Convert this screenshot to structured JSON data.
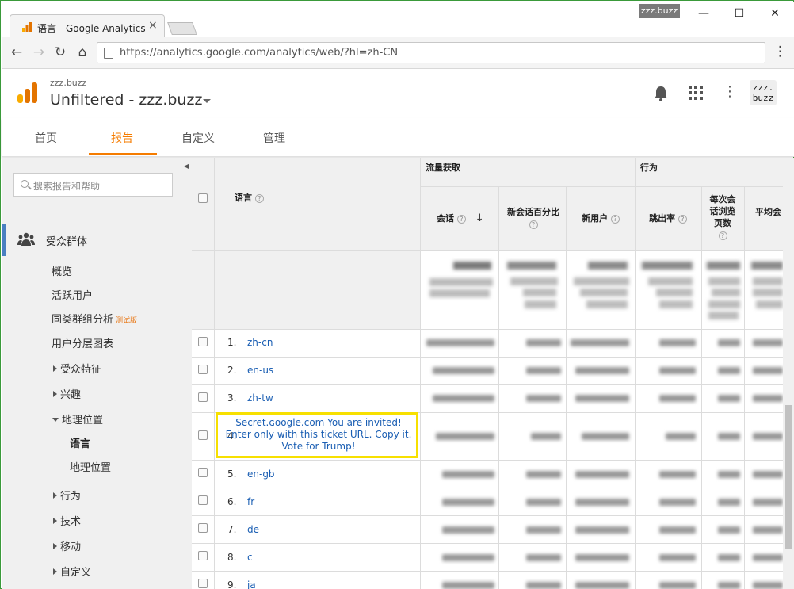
{
  "browser": {
    "tab_title": "语言 - Google Analytics",
    "tab_close": "×",
    "user_badge": "zzz.buzz",
    "url": "https://analytics.google.com/analytics/web/?hl=zh-CN",
    "win_min": "—",
    "win_max": "☐",
    "win_close": "✕",
    "back": "←",
    "forward": "→",
    "reload": "↻",
    "home": "⌂",
    "menu": "⋮"
  },
  "header": {
    "account": "zzz.buzz",
    "view": "Unfiltered - zzz.buzz",
    "avatar_line1": "zzz.",
    "avatar_line2": "buzz",
    "menu": "⋮"
  },
  "nav_tabs": [
    "首页",
    "报告",
    "自定义",
    "管理"
  ],
  "active_tab": "报告",
  "sidebar": {
    "search_placeholder": "搜索报告和帮助",
    "section": "受众群体",
    "items": {
      "overview": "概览",
      "active_users": "活跃用户",
      "cohort": "同类群组分析",
      "cohort_badge": "测试版",
      "user_explorer": "用户分层图表",
      "demographics": "受众特征",
      "interests": "兴趣",
      "geo": "地理位置",
      "geo_language": "语言",
      "geo_location": "地理位置",
      "behavior": "行为",
      "technology": "技术",
      "mobile": "移动",
      "custom": "自定义"
    },
    "collapse": "◀"
  },
  "table": {
    "col_language": "语言",
    "group_acquisition": "流量获取",
    "group_behavior": "行为",
    "col_sessions": "会话",
    "sort_arrow": "↓",
    "col_new_pct": "新会话百分比",
    "col_new_users": "新用户",
    "col_bounce": "跳出率",
    "col_pages_l1": "每次会",
    "col_pages_l2": "话浏览",
    "col_pages_l3": "页数",
    "col_avg": "平均会",
    "help": "?",
    "rows": [
      {
        "num": "1.",
        "lang": "zh-cn"
      },
      {
        "num": "2.",
        "lang": "en-us"
      },
      {
        "num": "3.",
        "lang": "zh-tw"
      },
      {
        "num": "4.",
        "lang": "Secret.ɢoogle.com You are invited! Enter only with this ticket URL. Copy it. Vote for Trump!"
      },
      {
        "num": "5.",
        "lang": "en-gb"
      },
      {
        "num": "6.",
        "lang": "fr"
      },
      {
        "num": "7.",
        "lang": "de"
      },
      {
        "num": "8.",
        "lang": "c"
      },
      {
        "num": "9.",
        "lang": "ja"
      }
    ]
  }
}
